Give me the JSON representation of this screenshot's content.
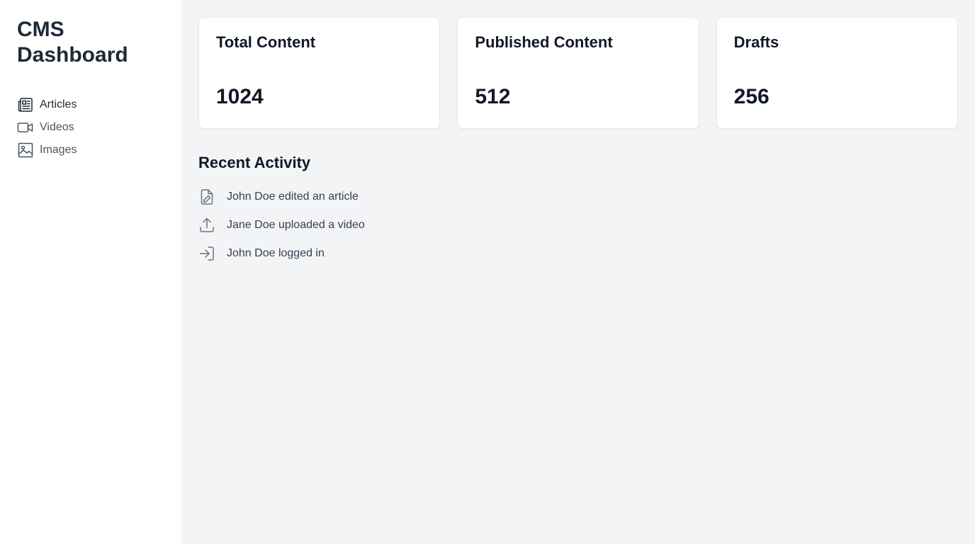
{
  "sidebar": {
    "brand": "CMS Dashboard",
    "items": [
      {
        "label": "Articles",
        "icon": "newspaper-icon",
        "active": true
      },
      {
        "label": "Videos",
        "icon": "video-camera-icon",
        "active": false
      },
      {
        "label": "Images",
        "icon": "image-icon",
        "active": false
      }
    ]
  },
  "stats": [
    {
      "title": "Total Content",
      "value": "1024"
    },
    {
      "title": "Published Content",
      "value": "512"
    },
    {
      "title": "Drafts",
      "value": "256"
    }
  ],
  "activity": {
    "title": "Recent Activity",
    "items": [
      {
        "text": "John Doe edited an article",
        "icon": "document-edit-icon"
      },
      {
        "text": "Jane Doe uploaded a video",
        "icon": "upload-icon"
      },
      {
        "text": "John Doe logged in",
        "icon": "login-icon"
      }
    ]
  },
  "colors": {
    "sidebar_bg": "#ffffff",
    "main_bg": "#f3f4f6",
    "text_dark": "#1f2937",
    "text_muted": "#4b5563",
    "icon_gray": "#6b7280"
  }
}
